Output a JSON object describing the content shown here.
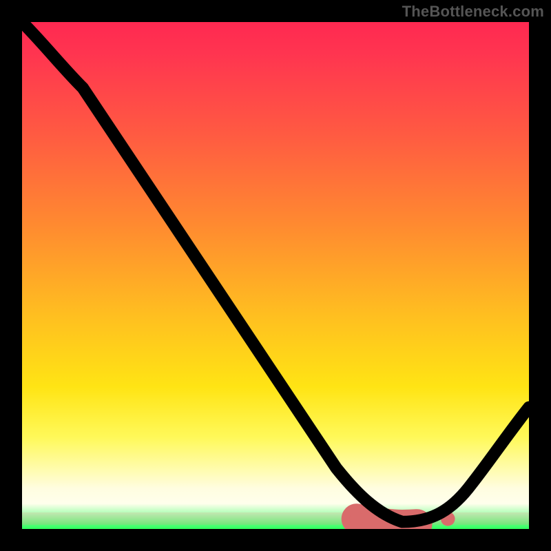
{
  "watermark": "TheBottleneck.com",
  "colors": {
    "page_bg": "#000000",
    "curve": "#000000",
    "trough_marker": "#d96b6b",
    "gradient_top": "#ff2951",
    "gradient_bottom": "#2fff5f"
  },
  "chart_data": {
    "type": "line",
    "title": "",
    "xlabel": "",
    "ylabel": "",
    "xlim": [
      0,
      100
    ],
    "ylim": [
      0,
      100
    ],
    "grid": false,
    "legend": false,
    "background": "vertical-gradient red→orange→yellow→green (low values green near bottom)",
    "series": [
      {
        "name": "bottleneck-curve",
        "x": [
          0,
          6,
          12,
          18,
          24,
          30,
          36,
          42,
          48,
          54,
          60,
          66,
          72,
          78,
          84,
          90,
          96,
          100
        ],
        "y": [
          100,
          94,
          87,
          78,
          69,
          60,
          51,
          42,
          33,
          24,
          16,
          9,
          4,
          2,
          2,
          6,
          16,
          24
        ]
      }
    ],
    "annotations": [
      {
        "name": "optimal-range-marker",
        "style": "dashed pink segment along trough",
        "x_start": 66,
        "x_end": 84,
        "y": 2
      }
    ],
    "notes": "No axis ticks, labels, legend, or title are visible. Values estimated from curve shape relative to 0–100 plot box; higher y = higher bottleneck (red), trough ≈ 0–4 in green band around x ≈ 72–82."
  }
}
